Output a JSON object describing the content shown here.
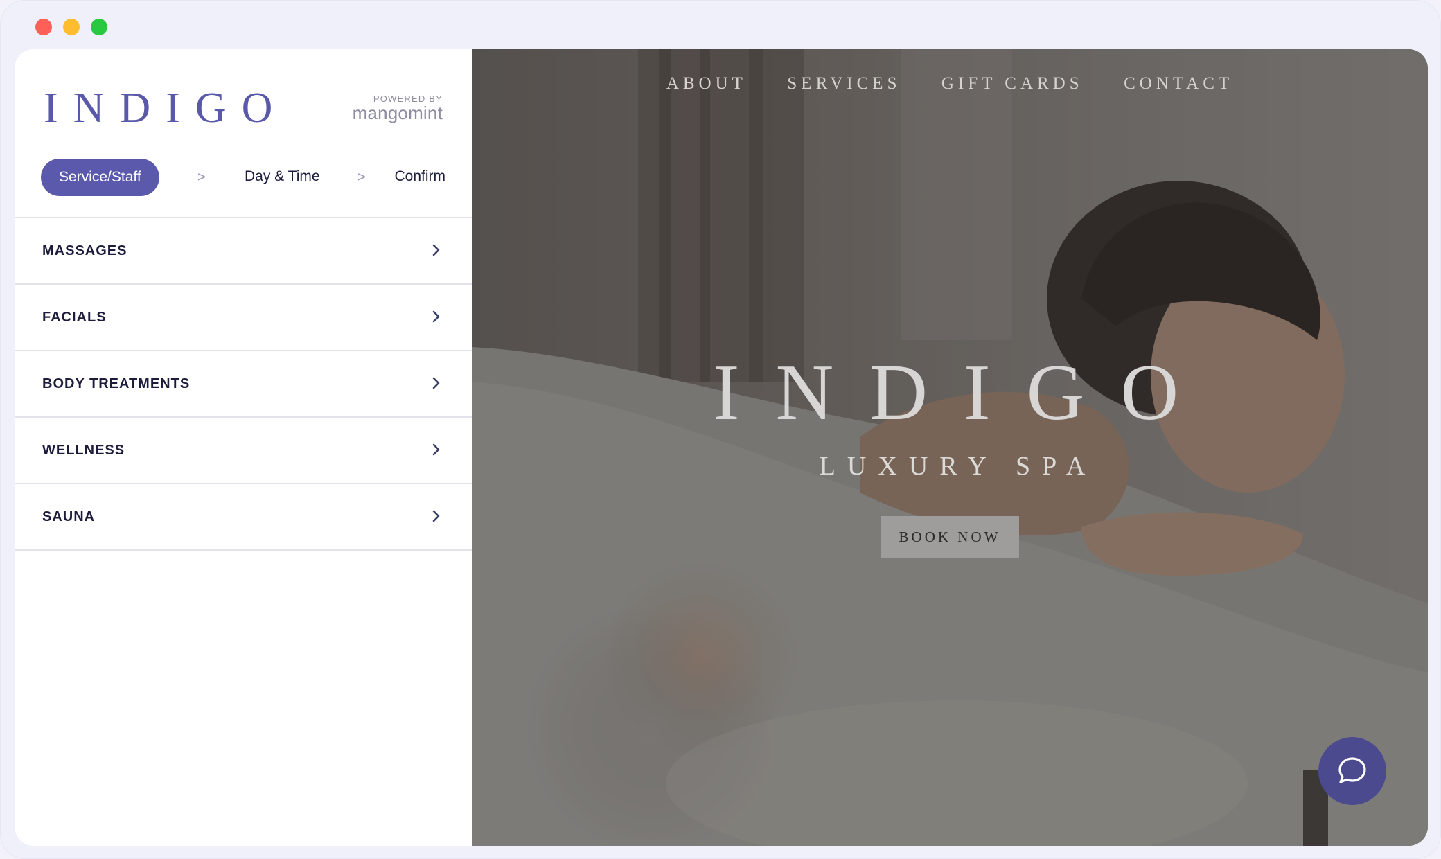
{
  "window": {
    "controls": [
      "close",
      "minimize",
      "maximize"
    ]
  },
  "booking": {
    "logo": "INDIGO",
    "powered_by_label": "POWERED BY",
    "powered_by_name": "mangomint",
    "steps": {
      "active": "Service/Staff",
      "separator": ">",
      "day_time": "Day & Time",
      "confirm": "Confirm"
    },
    "categories": [
      {
        "label": "MASSAGES"
      },
      {
        "label": "FACIALS"
      },
      {
        "label": "BODY TREATMENTS"
      },
      {
        "label": "WELLNESS"
      },
      {
        "label": "SAUNA"
      }
    ]
  },
  "hero": {
    "nav": {
      "about": "ABOUT",
      "services": "SERVICES",
      "gift_cards": "GIFT CARDS",
      "contact": "CONTACT"
    },
    "title": "INDIGO",
    "subtitle": "LUXURY SPA",
    "cta": "BOOK NOW",
    "chat_icon": "chat-bubble-icon"
  },
  "colors": {
    "brand": "#5b59ab",
    "text_dark": "#1d1c3c",
    "chat_button": "#4b4a8e"
  }
}
